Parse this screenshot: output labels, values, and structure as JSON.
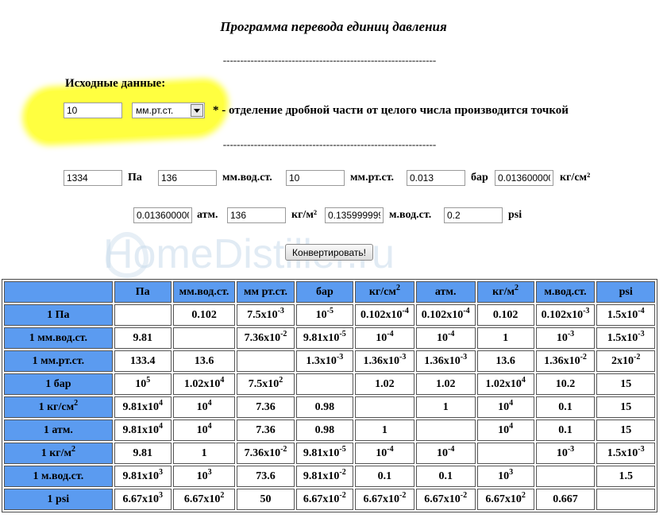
{
  "title": "Программа перевода единиц давления",
  "separator": "--------------------------------------------------------------",
  "source": {
    "label": "Исходные данные:",
    "value": "10",
    "unit_selected": "мм.рт.ст.",
    "note": "* - отделение дробной части от целого числа производится точкой"
  },
  "results_row1": [
    {
      "value": "1334",
      "unit": "Па"
    },
    {
      "value": "136",
      "unit": "мм.вод.ст."
    },
    {
      "value": "10",
      "unit": "мм.рт.ст."
    },
    {
      "value": "0.013",
      "unit": "бар"
    },
    {
      "value": "0.013600000",
      "unit": "кг/см²"
    }
  ],
  "results_row2": [
    {
      "value": "0.0136000000",
      "unit": "атм."
    },
    {
      "value": "136",
      "unit": "кг/м²"
    },
    {
      "value": "0.135999999",
      "unit": "м.вод.ст."
    },
    {
      "value": "0.2",
      "unit": "psi"
    }
  ],
  "convert_label": "Конвертировать!",
  "watermark": "HomeDistiller.ru",
  "table": {
    "headers": [
      {
        "t": ""
      },
      {
        "t": "Па"
      },
      {
        "t": "мм.вод.ст."
      },
      {
        "t": "мм рт.ст."
      },
      {
        "t": "бар"
      },
      {
        "t": "кг/см",
        "sup": "2"
      },
      {
        "t": "атм."
      },
      {
        "t": "кг/м",
        "sup": "2"
      },
      {
        "t": "м.вод.ст."
      },
      {
        "t": "psi"
      }
    ],
    "rows": [
      {
        "label": {
          "t": "1 Па"
        },
        "cells": [
          {
            "t": ""
          },
          {
            "t": "0.102"
          },
          {
            "t": "7.5x10",
            "sup": "-3"
          },
          {
            "t": "10",
            "sup": "-5"
          },
          {
            "t": "0.102x10",
            "sup": "-4"
          },
          {
            "t": "0.102x10",
            "sup": "-4"
          },
          {
            "t": "0.102"
          },
          {
            "t": "0.102x10",
            "sup": "-3"
          },
          {
            "t": "1.5x10",
            "sup": "-4"
          }
        ]
      },
      {
        "label": {
          "t": "1 мм.вод.ст."
        },
        "cells": [
          {
            "t": "9.81"
          },
          {
            "t": ""
          },
          {
            "t": "7.36x10",
            "sup": "-2"
          },
          {
            "t": "9.81x10",
            "sup": "-5"
          },
          {
            "t": "10",
            "sup": "-4"
          },
          {
            "t": "10",
            "sup": "-4"
          },
          {
            "t": "1"
          },
          {
            "t": "10",
            "sup": "-3"
          },
          {
            "t": "1.5x10",
            "sup": "-3"
          }
        ]
      },
      {
        "label": {
          "t": "1 мм.рт.ст."
        },
        "cells": [
          {
            "t": "133.4"
          },
          {
            "t": "13.6"
          },
          {
            "t": ""
          },
          {
            "t": "1.3x10",
            "sup": "-3"
          },
          {
            "t": "1.36x10",
            "sup": "-3"
          },
          {
            "t": "1.36x10",
            "sup": "-3"
          },
          {
            "t": "13.6"
          },
          {
            "t": "1.36x10",
            "sup": "-2"
          },
          {
            "t": "2x10",
            "sup": "-2"
          }
        ]
      },
      {
        "label": {
          "t": "1 бар"
        },
        "cells": [
          {
            "t": "10",
            "sup": "5"
          },
          {
            "t": "1.02x10",
            "sup": "4"
          },
          {
            "t": "7.5x10",
            "sup": "2"
          },
          {
            "t": ""
          },
          {
            "t": "1.02"
          },
          {
            "t": "1.02"
          },
          {
            "t": "1.02x10",
            "sup": "4"
          },
          {
            "t": "10.2"
          },
          {
            "t": "15"
          }
        ]
      },
      {
        "label": {
          "t": "1 кг/см",
          "sup": "2"
        },
        "cells": [
          {
            "t": "9.81x10",
            "sup": "4"
          },
          {
            "t": "10",
            "sup": "4"
          },
          {
            "t": "7.36"
          },
          {
            "t": "0.98"
          },
          {
            "t": ""
          },
          {
            "t": "1"
          },
          {
            "t": "10",
            "sup": "4"
          },
          {
            "t": "0.1"
          },
          {
            "t": "15"
          }
        ]
      },
      {
        "label": {
          "t": "1 атм."
        },
        "cells": [
          {
            "t": "9.81x10",
            "sup": "4"
          },
          {
            "t": "10",
            "sup": "4"
          },
          {
            "t": "7.36"
          },
          {
            "t": "0.98"
          },
          {
            "t": "1"
          },
          {
            "t": ""
          },
          {
            "t": "10",
            "sup": "4"
          },
          {
            "t": "0.1"
          },
          {
            "t": "15"
          }
        ]
      },
      {
        "label": {
          "t": "1 кг/м",
          "sup": "2"
        },
        "cells": [
          {
            "t": "9.81"
          },
          {
            "t": "1"
          },
          {
            "t": "7.36x10",
            "sup": "-2"
          },
          {
            "t": "9.81x10",
            "sup": "-5"
          },
          {
            "t": "10",
            "sup": "-4"
          },
          {
            "t": "10",
            "sup": "-4"
          },
          {
            "t": ""
          },
          {
            "t": "10",
            "sup": "-3"
          },
          {
            "t": "1.5x10",
            "sup": "-3"
          }
        ]
      },
      {
        "label": {
          "t": "1 м.вод.ст."
        },
        "cells": [
          {
            "t": "9.81x10",
            "sup": "3"
          },
          {
            "t": "10",
            "sup": "3"
          },
          {
            "t": "73.6"
          },
          {
            "t": "9.81x10",
            "sup": "-2"
          },
          {
            "t": "0.1"
          },
          {
            "t": "0.1"
          },
          {
            "t": "10",
            "sup": "3"
          },
          {
            "t": ""
          },
          {
            "t": "1.5"
          }
        ]
      },
      {
        "label": {
          "t": "1 psi"
        },
        "cells": [
          {
            "t": "6.67x10",
            "sup": "3"
          },
          {
            "t": "6.67x10",
            "sup": "2"
          },
          {
            "t": "50"
          },
          {
            "t": "6.67x10",
            "sup": "-2"
          },
          {
            "t": "6.67x10",
            "sup": "-2"
          },
          {
            "t": "6.67x10",
            "sup": "-2"
          },
          {
            "t": "6.67x10",
            "sup": "2"
          },
          {
            "t": "0.667"
          },
          {
            "t": ""
          }
        ]
      }
    ]
  }
}
